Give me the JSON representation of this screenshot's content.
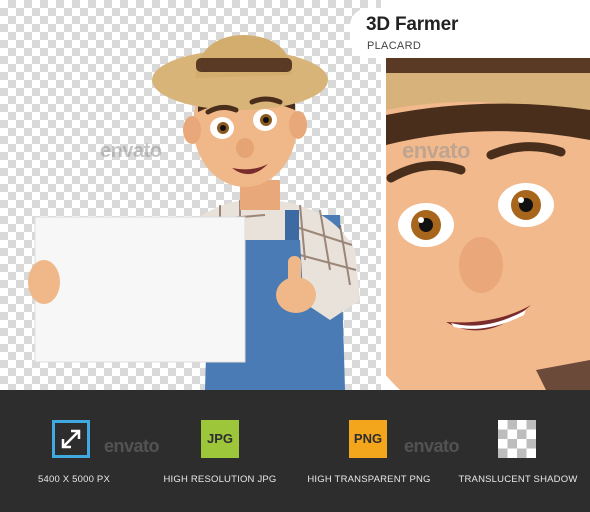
{
  "header": {
    "title": "3D Farmer",
    "subtitle": "PLACARD"
  },
  "watermark": "envato",
  "features": [
    {
      "label": "5400 X 5000 PX",
      "icon": "resize-arrows-icon"
    },
    {
      "label": "HIGH RESOLUTION JPG",
      "icon_text": "JPG"
    },
    {
      "label": "HIGH TRANSPARENT PNG",
      "icon_text": "PNG"
    },
    {
      "label": "TRANSLUCENT SHADOW",
      "icon": "checkerboard-icon"
    }
  ],
  "colors": {
    "bar": "#2d2d2d",
    "size_icon": "#3fa9e0",
    "jpg_icon": "#9dc63a",
    "png_icon": "#f3a61c"
  }
}
